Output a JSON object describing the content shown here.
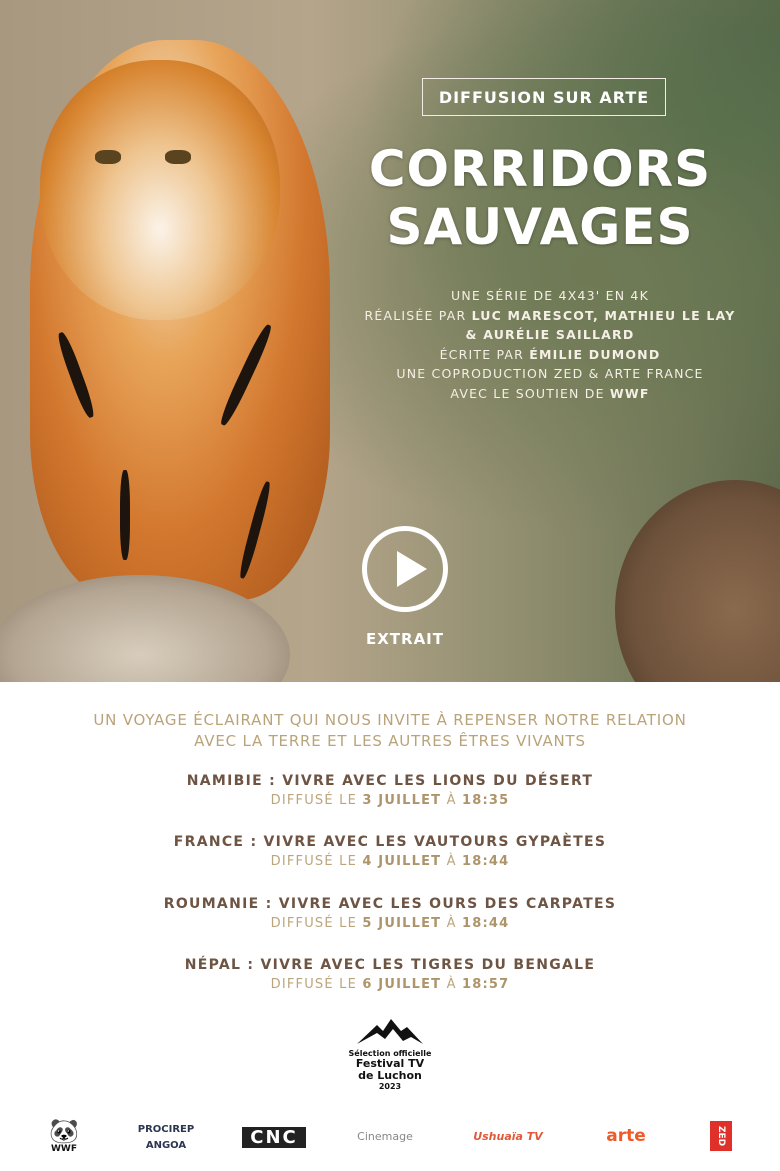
{
  "hero": {
    "badge": "DIFFUSION SUR ARTE",
    "title_line1": "CORRIDORS",
    "title_line2": "SAUVAGES",
    "credits": {
      "line1": "UNE SÉRIE DE 4X43' EN 4K",
      "line2_prefix": "RÉALISÉE PAR ",
      "line2_names": "LUC MARESCOT, MATHIEU LE LAY",
      "line3": "& AURÉLIE SAILLARD",
      "line4_prefix": "ÉCRITE PAR ",
      "line4_name": "ÉMILIE DUMOND",
      "line5": "UNE COPRODUCTION ZED & ARTE FRANCE",
      "line6_prefix": "AVEC LE SOUTIEN DE ",
      "line6_name": "WWF"
    },
    "play_label": "EXTRAIT"
  },
  "tagline": {
    "line1": "UN VOYAGE ÉCLAIRANT QUI NOUS INVITE À REPENSER NOTRE RELATION",
    "line2": "AVEC LA TERRE ET LES AUTRES ÊTRES VIVANTS"
  },
  "episodes": [
    {
      "title": "NAMIBIE : VIVRE AVEC LES LIONS DU DÉSERT",
      "prefix": "DIFFUSÉ LE ",
      "date": "3 JUILLET",
      "mid": " À ",
      "time": "18:35"
    },
    {
      "title": "FRANCE : VIVRE AVEC LES VAUTOURS GYPAÈTES",
      "prefix": "DIFFUSÉ LE ",
      "date": "4 JUILLET",
      "mid": " À ",
      "time": "18:44"
    },
    {
      "title": "ROUMANIE : VIVRE AVEC LES OURS DES CARPATES",
      "prefix": "DIFFUSÉ LE ",
      "date": "5 JUILLET",
      "mid": " À ",
      "time": "18:44"
    },
    {
      "title": "NÉPAL : VIVRE AVEC LES TIGRES DU BENGALE",
      "prefix": "DIFFUSÉ LE ",
      "date": "6 JUILLET",
      "mid": " À ",
      "time": "18:57"
    }
  ],
  "festival": {
    "line1": "Sélection officielle",
    "line2": "Festival TV",
    "line3": "de Luchon",
    "year": "2023"
  },
  "logos": [
    "WWF",
    "PROCIREP ANGOA",
    "CNC",
    "Cinemage",
    "Ushuaïa TV",
    "arte",
    "ZED"
  ],
  "colors": {
    "tagline": "#b9a37a",
    "episode_title": "#6e5443",
    "episode_date": "#bba57d",
    "arte": "#f05a28",
    "zed": "#e0302a"
  }
}
